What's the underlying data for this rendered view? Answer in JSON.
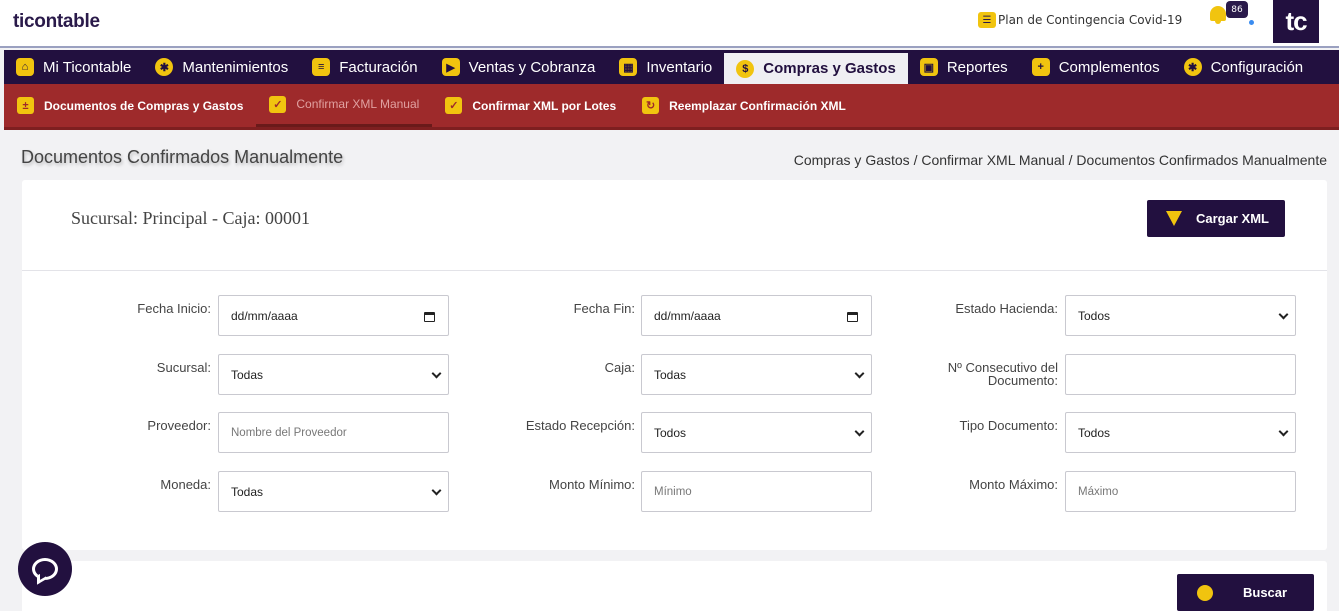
{
  "header": {
    "logo": "ticontable",
    "covid_link": "Plan de Contingencia Covid-19",
    "notifications_count": "86",
    "avatar_initials": "tc"
  },
  "main_nav": [
    {
      "label": "Mi Ticontable",
      "icon": "home-icon",
      "active": false
    },
    {
      "label": "Mantenimientos",
      "icon": "gear-icon",
      "active": false
    },
    {
      "label": "Facturación",
      "icon": "invoice-icon",
      "active": false
    },
    {
      "label": "Ventas y Cobranza",
      "icon": "truck-icon",
      "active": false
    },
    {
      "label": "Inventario",
      "icon": "boxes-icon",
      "active": false
    },
    {
      "label": "Compras y Gastos",
      "icon": "money-bag-icon",
      "active": true
    },
    {
      "label": "Reportes",
      "icon": "presentation-icon",
      "active": false
    },
    {
      "label": "Complementos",
      "icon": "plus-icon",
      "active": false
    },
    {
      "label": "Configuración",
      "icon": "gear-icon",
      "active": false
    }
  ],
  "sub_nav": [
    {
      "label": "Documentos de Compras y Gastos",
      "icon": "clipboard-icon",
      "active": false
    },
    {
      "label": "Confirmar XML Manual",
      "icon": "clipboard-check-icon",
      "active": true
    },
    {
      "label": "Confirmar XML por Lotes",
      "icon": "clipboard-check-icon",
      "active": false
    },
    {
      "label": "Reemplazar Confirmación XML",
      "icon": "refresh-icon",
      "active": false
    }
  ],
  "page": {
    "title": "Documentos Confirmados Manualmente",
    "breadcrumb": "Compras y Gastos / Confirmar XML Manual / Documentos Confirmados Manualmente",
    "sucursal_info": "Sucursal: Principal - Caja: 00001",
    "cargar_label": "Cargar XML",
    "buscar_label": "Buscar"
  },
  "filters": {
    "fecha_inicio": {
      "label": "Fecha Inicio:",
      "value": "dd/mm/aaaa"
    },
    "fecha_fin": {
      "label": "Fecha Fin:",
      "value": "dd/mm/aaaa"
    },
    "estado_hacienda": {
      "label": "Estado Hacienda:",
      "value": "Todos"
    },
    "sucursal": {
      "label": "Sucursal:",
      "value": "Todas"
    },
    "caja": {
      "label": "Caja:",
      "value": "Todas"
    },
    "consecutivo": {
      "label_line1": "Nº Consecutivo del",
      "label_line2": "Documento:",
      "value": ""
    },
    "proveedor": {
      "label": "Proveedor:",
      "placeholder": "Nombre del Proveedor"
    },
    "estado_recepcion": {
      "label": "Estado Recepción:",
      "value": "Todos"
    },
    "tipo_documento": {
      "label": "Tipo Documento:",
      "value": "Todos"
    },
    "moneda": {
      "label": "Moneda:",
      "value": "Todas"
    },
    "monto_minimo": {
      "label": "Monto Mínimo:",
      "placeholder": "Mínimo"
    },
    "monto_maximo": {
      "label": "Monto Máximo:",
      "placeholder": "Máximo"
    }
  },
  "colors": {
    "primary": "#22103f",
    "accent": "#f1c40f",
    "subnav": "#9e2a2b"
  }
}
